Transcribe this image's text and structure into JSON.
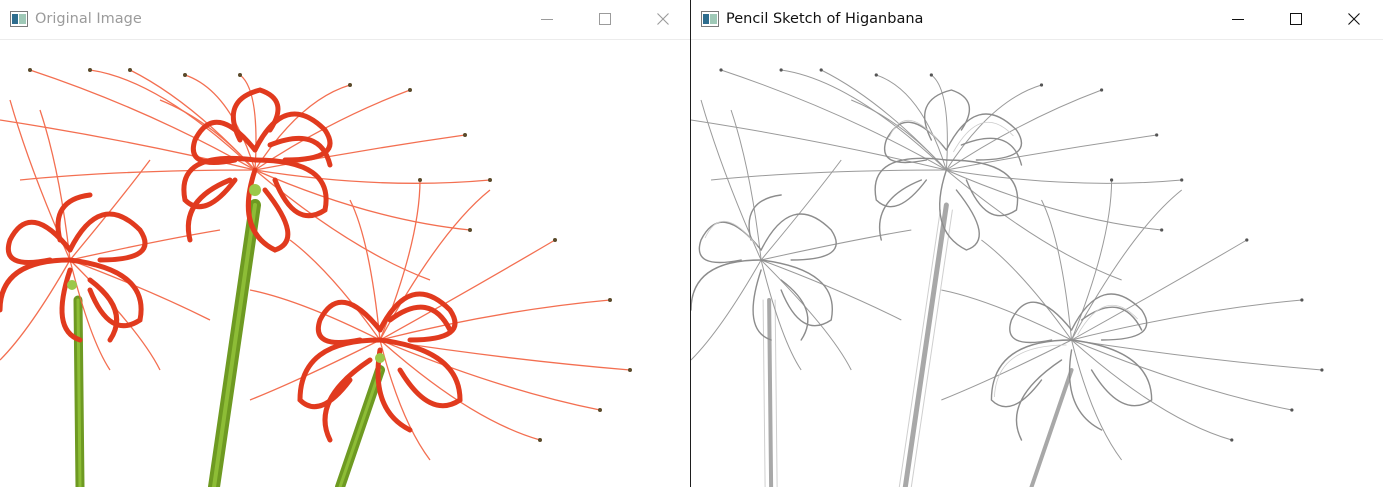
{
  "windows": [
    {
      "title": "Original Image",
      "focused": false,
      "controls": {
        "minimize": "minimize-icon",
        "maximize": "maximize-icon",
        "close": "close-icon"
      },
      "image": "red spider lily (higanbana) photograph",
      "colors": {
        "petal": "#f04a2c",
        "stem": "#6e9a22",
        "title": "#9b9b9b"
      }
    },
    {
      "title": "Pencil Sketch of Higanbana",
      "focused": true,
      "controls": {
        "minimize": "minimize-icon",
        "maximize": "maximize-icon",
        "close": "close-icon"
      },
      "image": "pencil sketch of the spider lily",
      "colors": {
        "line": "#9a9a9a",
        "title": "#111111"
      }
    }
  ]
}
